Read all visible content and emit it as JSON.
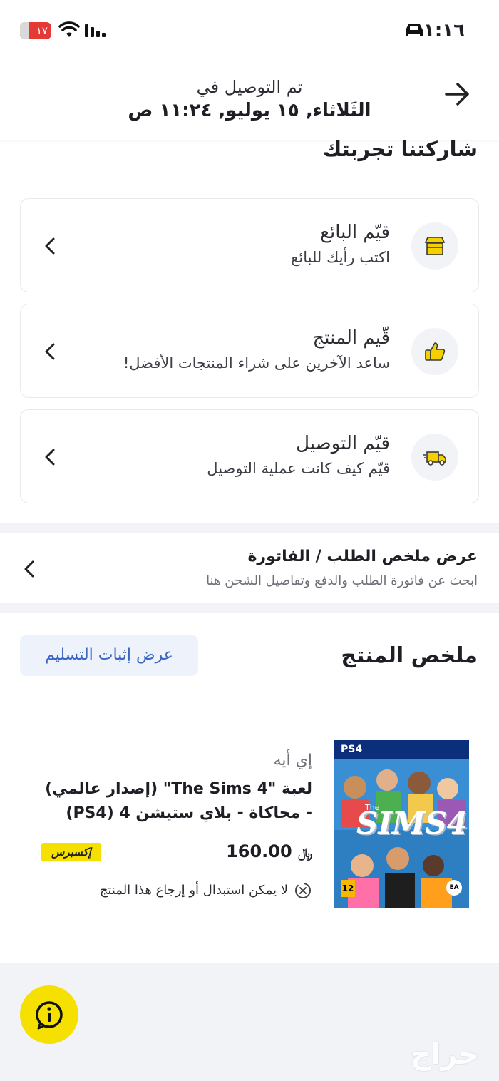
{
  "status_bar": {
    "time": "١:١٦",
    "battery": "١٧"
  },
  "header": {
    "subtitle": "تم التوصيل في",
    "title": "الثَلاثاء, ١٥ يوليو, ١١:٢٤ ص"
  },
  "share": {
    "title": "شاركتنا تجربتك",
    "cards": [
      {
        "title": "قيّم البائع",
        "subtitle": "اكتب رأيك للبائع",
        "icon": "store-icon"
      },
      {
        "title": "قّيم المنتج",
        "subtitle": "ساعد الآخرين على شراء المنتجات الأفضل!",
        "icon": "thumbs-up-icon"
      },
      {
        "title": "قيّم التوصيل",
        "subtitle": "قيّم كيف كانت عملية التوصيل",
        "icon": "delivery-truck-icon"
      }
    ]
  },
  "invoice": {
    "title": "عرض ملخص الطلب / الفاتورة",
    "subtitle": "ابحث عن فاتورة الطلب والدفع وتفاصيل الشحن هنا"
  },
  "summary": {
    "title": "ملخص المنتج",
    "proof_button": "عرض إثبات التسليم"
  },
  "product": {
    "brand": "إي أيه",
    "name": "لعبة \"The Sims 4\" (إصدار عالمي) - محاكاة - بلاي ستيشن 4 (PS4)",
    "price": "160.00",
    "currency_symbol": "﷼",
    "badge": "إكسبرس",
    "return_note": "لا يمكن استبدال أو إرجاع هذا المنتج",
    "cover": {
      "platform": "PS4",
      "the": "The",
      "logo": "SIMS4",
      "pegi": "12",
      "publisher": "EA"
    }
  },
  "watermark": "حراج",
  "colors": {
    "accent_yellow": "#f5e000",
    "link_blue": "#3b66c4",
    "icon_yellow": "#f5d000",
    "bg_gray": "#f1f3f7"
  }
}
